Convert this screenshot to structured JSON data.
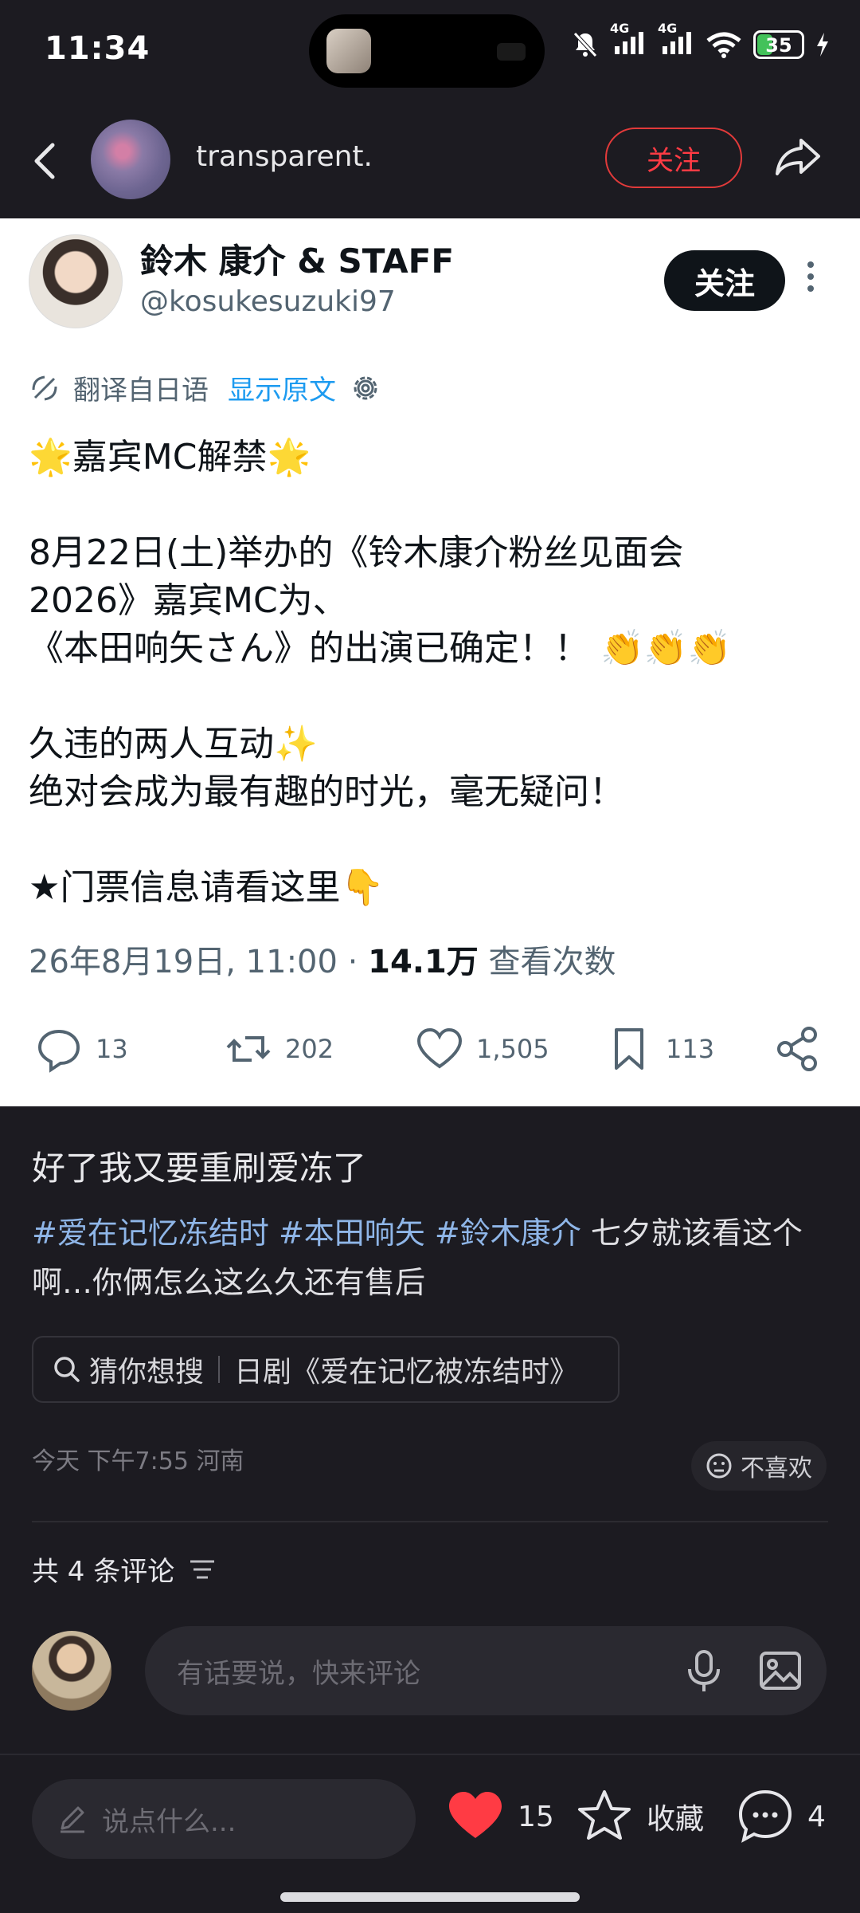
{
  "status_bar": {
    "time": "11:34",
    "signal_1": "4G",
    "signal_2": "4G",
    "battery": "35",
    "battery_level": 0.35
  },
  "header": {
    "username": "transparent.",
    "follow_label": "关注"
  },
  "tweet": {
    "name": "鈴木 康介 & STAFF",
    "handle": "@kosukesuzuki97",
    "follow_label": "关注",
    "translated_from": "翻译自日语",
    "show_original": "显示原文",
    "lines": [
      "🌟嘉宾MC解禁🌟",
      "",
      "8月22日(土)举办的《铃木康介粉丝见面会",
      "2026》嘉宾MC为、",
      "《本田响矢さん》的出演已确定！！ 👏👏👏",
      "",
      "久违的两人互动✨",
      "绝对会成为最有趣的时光，毫无疑问！",
      "",
      "★门票信息请看这里👇"
    ],
    "date": "26年8月19日, 11:00",
    "dot": "·",
    "views": "14.1万",
    "views_label": "查看次数",
    "replies": "13",
    "retweets": "202",
    "likes": "1,505",
    "bookmarks": "113"
  },
  "post": {
    "title": "好了我又要重刷爱冻了",
    "tags": [
      "#爱在记忆冻结时",
      "#本田响矢",
      "#鈴木康介"
    ],
    "text_after_tags": "七夕就该看这个啊…你俩怎么这么久还有售后",
    "suggest_prefix": "猜你想搜",
    "suggest_query": "日剧《爱在记忆被冻结时》",
    "date": "今天 下午7:55 河南",
    "dislike_label": "不喜欢",
    "comment_count_label": "共 4 条评论"
  },
  "comment_input": {
    "placeholder": "有话要说，快来评论"
  },
  "bottom_bar": {
    "say_placeholder": "说点什么...",
    "likes": "15",
    "collect_label": "收藏",
    "comments": "4"
  },
  "colors": {
    "accent_red": "#ff3b44",
    "link_blue": "#1d9bf0",
    "tag_blue": "#8fb6e8",
    "battery_green": "#43c25a"
  }
}
